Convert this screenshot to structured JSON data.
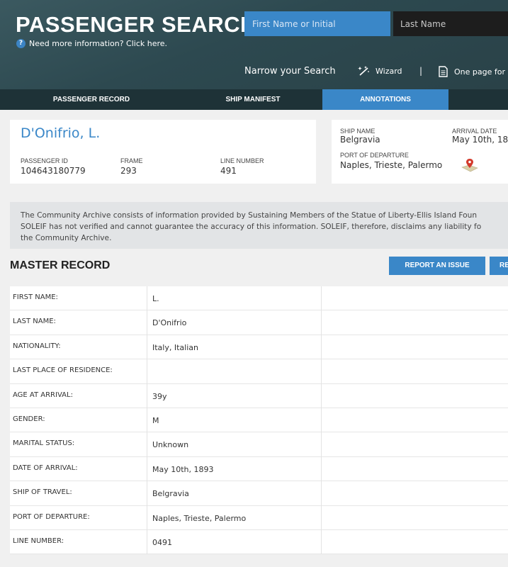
{
  "header": {
    "title": "PASSENGER SEARCH",
    "help_text": "Need more information? Click here.",
    "first_name_placeholder": "First Name or Initial",
    "last_name_placeholder": "Last Name",
    "narrow_label": "Narrow your Search",
    "wizard_label": "Wizard",
    "separator": "|",
    "one_page_label": "One page for"
  },
  "tabs": [
    {
      "label": "PASSENGER RECORD",
      "active": false
    },
    {
      "label": "SHIP MANIFEST",
      "active": false
    },
    {
      "label": "ANNOTATIONS",
      "active": true
    }
  ],
  "passenger": {
    "name": "D'Onifrio, L.",
    "id_label": "PASSENGER ID",
    "id": "104643180779",
    "frame_label": "FRAME",
    "frame": "293",
    "line_label": "LINE NUMBER",
    "line": "491"
  },
  "ship": {
    "name_label": "SHIP NAME",
    "name": "Belgravia",
    "arrival_label": "ARRIVAL DATE",
    "arrival": "May 10th, 18",
    "port_label": "PORT OF DEPARTURE",
    "port": "Naples, Trieste, Palermo"
  },
  "notice": {
    "line1": "The Community Archive consists of information provided by Sustaining Members of the Statue of Liberty-Ellis Island Foun",
    "line2": "SOLEIF has not verified and cannot guarantee the accuracy of this information. SOLEIF, therefore, disclaims any liability fo",
    "line3": "the Community Archive."
  },
  "master": {
    "title": "MASTER RECORD",
    "report_button": "REPORT AN ISSUE",
    "second_button": "RE",
    "rows": [
      {
        "label": "FIRST NAME:",
        "value": "L."
      },
      {
        "label": "LAST NAME:",
        "value": "D'Onifrio"
      },
      {
        "label": "NATIONALITY:",
        "value": "Italy, Italian"
      },
      {
        "label": "LAST PLACE OF RESIDENCE:",
        "value": ""
      },
      {
        "label": "AGE AT ARRIVAL:",
        "value": "39y"
      },
      {
        "label": "GENDER:",
        "value": "M"
      },
      {
        "label": "MARITAL STATUS:",
        "value": "Unknown"
      },
      {
        "label": "DATE OF ARRIVAL:",
        "value": "May 10th, 1893"
      },
      {
        "label": "SHIP OF TRAVEL:",
        "value": "Belgravia"
      },
      {
        "label": "PORT OF DEPARTURE:",
        "value": "Naples, Trieste, Palermo"
      },
      {
        "label": "LINE NUMBER:",
        "value": "0491"
      }
    ]
  },
  "colors": {
    "header_bg": "#2f4b52",
    "accent_blue": "#3a87c8",
    "tabbar_bg": "#1e3237",
    "passenger_name": "#3a87c8"
  }
}
